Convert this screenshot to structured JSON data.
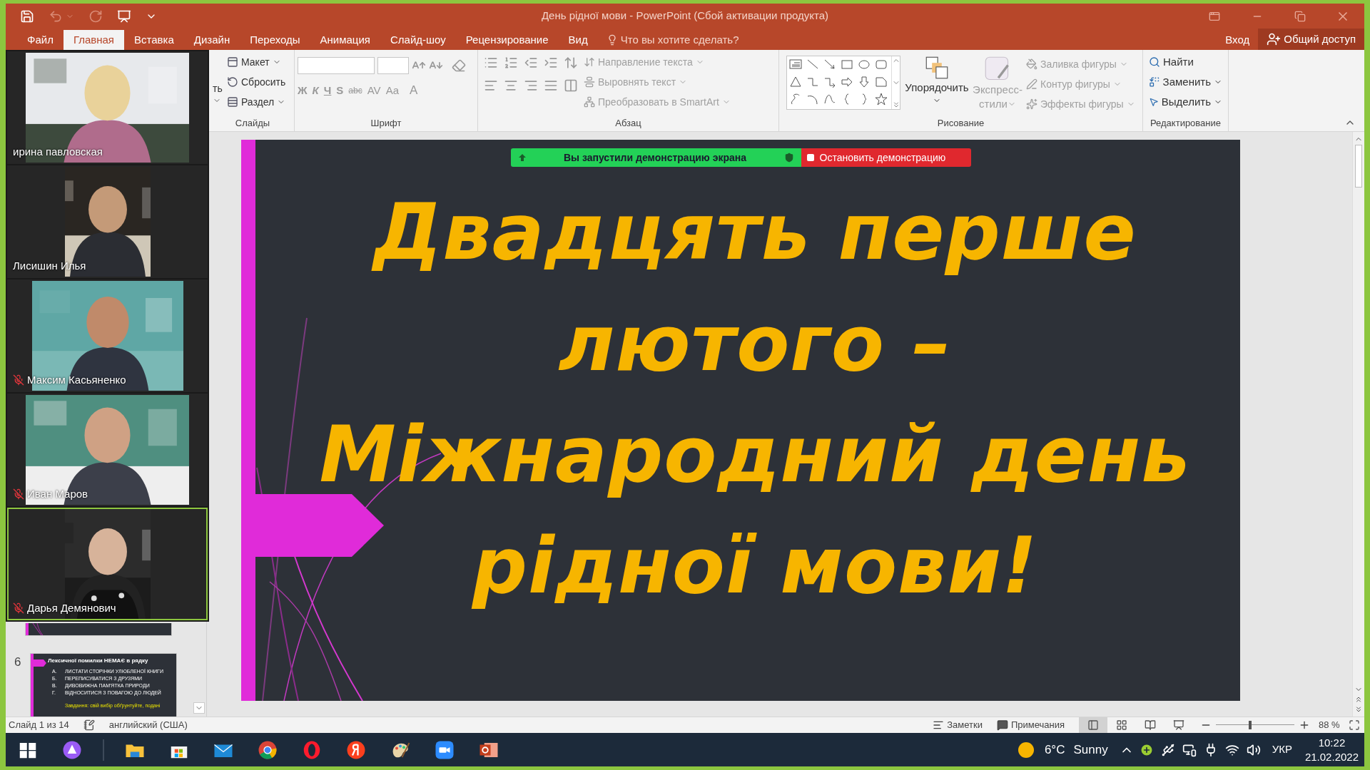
{
  "window": {
    "title": "День рідної мови - PowerPoint (Сбой активации продукта)"
  },
  "menu_tabs": [
    {
      "label": "Файл",
      "selected": false
    },
    {
      "label": "Главная",
      "selected": true
    },
    {
      "label": "Вставка",
      "selected": false
    },
    {
      "label": "Дизайн",
      "selected": false
    },
    {
      "label": "Переходы",
      "selected": false
    },
    {
      "label": "Анимация",
      "selected": false
    },
    {
      "label": "Слайд-шоу",
      "selected": false
    },
    {
      "label": "Рецензирование",
      "selected": false
    },
    {
      "label": "Вид",
      "selected": false
    }
  ],
  "tell_me": {
    "placeholder": "Что вы хотите сделать?"
  },
  "sign_in": "Вход",
  "share": "Общий доступ",
  "ribbon": {
    "slides": {
      "label": "Слайды",
      "cut_button": "ть",
      "buttons": [
        "Макет",
        "Сбросить",
        "Раздел"
      ]
    },
    "font": {
      "label": "Шрифт",
      "format_buttons": [
        "Ж",
        "К",
        "Ч",
        "S",
        "abc",
        "AV",
        "Aa",
        "A"
      ]
    },
    "paragraph": {
      "label": "Абзац",
      "buttons": [
        {
          "label": "Направление текста",
          "disabled": true
        },
        {
          "label": "Выровнять текст",
          "disabled": true
        },
        {
          "label": "Преобразовать в SmartArt",
          "disabled": true
        }
      ]
    },
    "drawing": {
      "label": "Рисование",
      "arrange": "Упорядочить",
      "quick_styles": [
        "Экспресс-",
        "стили"
      ],
      "shape_buttons": [
        {
          "label": "Заливка фигуры",
          "disabled": true
        },
        {
          "label": "Контур фигуры",
          "disabled": true
        },
        {
          "label": "Эффекты фигуры",
          "disabled": true
        }
      ]
    },
    "editing": {
      "label": "Редактирование",
      "buttons": [
        {
          "label": "Найти",
          "disabled": false
        },
        {
          "label": "Заменить",
          "disabled": false
        },
        {
          "label": "Выделить",
          "disabled": false
        }
      ]
    }
  },
  "participants": [
    {
      "name": "ирина павловская",
      "muted": false,
      "selected": false
    },
    {
      "name": "Лисишин Илья",
      "muted": false,
      "selected": false
    },
    {
      "name": "Максим Касьяненко",
      "muted": true,
      "selected": false
    },
    {
      "name": "Иван Маров",
      "muted": true,
      "selected": false
    },
    {
      "name": "Дарья Демянович",
      "muted": true,
      "selected": true
    }
  ],
  "thumbnails": [
    {
      "number": "6",
      "title": "Лексичної помилки НЕМАЄ в рядку",
      "items": [
        {
          "letter": "А.",
          "text": "ЛИСТАТИ СТОРІНКИ УЛЮБЛЕНОЇ КНИГИ"
        },
        {
          "letter": "Б.",
          "text": "ПЕРЕПИСУВАТИСЯ З ДРУЗЯМИ"
        },
        {
          "letter": "В.",
          "text": "ДИВОВИЖНА ПАМ'ЯТКА ПРИРОДИ"
        },
        {
          "letter": "Г.",
          "text": "ВІДНОСИТИСЯ З ПОВАГОЮ ДО ЛЮДЕЙ"
        }
      ],
      "note": "Завдання: свій вибір обґрунтуйте, подані"
    }
  ],
  "share_banner": {
    "status": "Вы запустили демонстрацию экрана",
    "stop": "Остановить демонстрацию"
  },
  "slide": {
    "title_lines": [
      "Двадцять перше",
      "лютого –",
      "Міжнародний день",
      "рідної мови!"
    ]
  },
  "status_bar": {
    "slide": "Слайд 1 из 14",
    "language": "английский (США)",
    "notes": "Заметки",
    "comments": "Примечания",
    "views": [
      {
        "kind": "normal",
        "selected": true
      },
      {
        "kind": "sorter",
        "selected": false
      },
      {
        "kind": "reading",
        "selected": false
      },
      {
        "kind": "slideshow",
        "selected": false
      }
    ],
    "zoom": {
      "level": 0.44,
      "reading": "88 %"
    }
  },
  "taskbar": {
    "apps": [
      {
        "kind": "windows"
      },
      {
        "kind": "alice"
      },
      {
        "kind": "explorer"
      },
      {
        "kind": "store"
      },
      {
        "kind": "mail"
      },
      {
        "kind": "chrome"
      },
      {
        "kind": "opera"
      },
      {
        "kind": "yandex"
      },
      {
        "kind": "paint"
      },
      {
        "kind": "zoom"
      },
      {
        "kind": "powerpoint"
      }
    ],
    "temperature": "6°C",
    "weather": "Sunny",
    "language": "УКР",
    "time": "10:22",
    "date": "21.02.2022"
  }
}
